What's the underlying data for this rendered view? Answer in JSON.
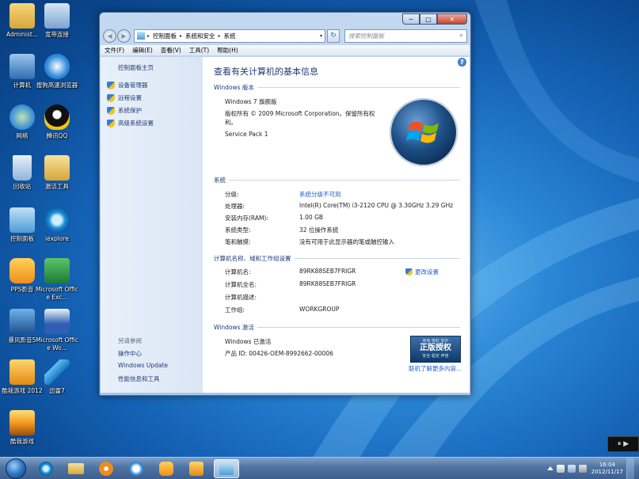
{
  "desktop": {
    "icons": [
      {
        "label": "Administ..."
      },
      {
        "label": "宽带连接"
      },
      {
        "label": "计算机"
      },
      {
        "label": "搜狗高速浏览器"
      },
      {
        "label": "网络"
      },
      {
        "label": "腾讯QQ"
      },
      {
        "label": "回收站"
      },
      {
        "label": "激活工具"
      },
      {
        "label": "控制面板"
      },
      {
        "label": "iexplore"
      },
      {
        "label": "PPS影音"
      },
      {
        "label": "Microsoft Office Exc..."
      },
      {
        "label": "暴风影音5"
      },
      {
        "label": "Microsoft Office Wo..."
      },
      {
        "label": "酷我游戏 2012"
      },
      {
        "label": "迅雷7"
      },
      {
        "label": "酷我游戏"
      }
    ]
  },
  "window": {
    "caption": {
      "min": "─",
      "max": "□",
      "close": "✕"
    },
    "nav": {
      "back": "◀",
      "forward": "▶"
    },
    "address": {
      "seg1": "控制面板",
      "seg2": "系统和安全",
      "seg3": "系统",
      "sep": "▸",
      "dropdown": "▾"
    },
    "refresh": "↻",
    "search": {
      "placeholder": "搜索控制面板",
      "icon": "⌕"
    },
    "menu": [
      "文件(F)",
      "编辑(E)",
      "查看(V)",
      "工具(T)",
      "帮助(H)"
    ],
    "left": {
      "home": "控制面板主页",
      "links": [
        "设备管理器",
        "远程设置",
        "系统保护",
        "高级系统设置"
      ],
      "see_also_title": "另请参阅",
      "see_also": [
        "操作中心",
        "Windows Update",
        "性能信息和工具"
      ]
    },
    "main": {
      "help": "?",
      "title": "查看有关计算机的基本信息",
      "edition": {
        "header": "Windows 版本",
        "name": "Windows 7 旗舰版",
        "copyright": "版权所有 © 2009 Microsoft Corporation。保留所有权利。",
        "sp": "Service Pack 1"
      },
      "system": {
        "header": "系统",
        "rating_label": "分级:",
        "rating_value": "系统分级不可用",
        "cpu_label": "处理器:",
        "cpu_value": "Intel(R) Core(TM) i3-2120 CPU @ 3.30GHz   3.29 GHz",
        "ram_label": "安装内存(RAM):",
        "ram_value": "1.00 GB",
        "type_label": "系统类型:",
        "type_value": "32 位操作系统",
        "pen_label": "笔和触摸:",
        "pen_value": "没有可用于此显示器的笔或触控输入"
      },
      "computer": {
        "header": "计算机名称、域和工作组设置",
        "name_label": "计算机名:",
        "name_value": "89RK88SEB7FRIGR",
        "full_label": "计算机全名:",
        "full_value": "89RK88SEB7FRIGR",
        "desc_label": "计算机描述:",
        "wg_label": "工作组:",
        "wg_value": "WORKGROUP",
        "change": "更改设置"
      },
      "activation": {
        "header": "Windows 激活",
        "status": "Windows 已激活",
        "product_id": "产品 ID: 00426-OEM-8992662-00006",
        "badge_small": "使用 微软 软件",
        "badge_big": "正版授权",
        "badge_bottom": "安全 稳定 声誉",
        "more": "联机了解更多内容..."
      }
    }
  },
  "taskbar": {
    "time": "16:04",
    "date": "2012/11/17"
  },
  "corner_widget": "⏸ ▶"
}
